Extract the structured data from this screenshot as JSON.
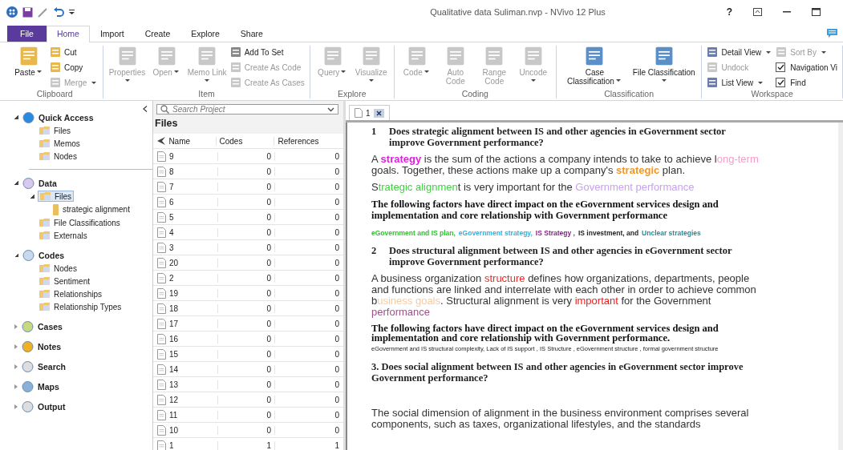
{
  "window": {
    "title": "Qualitative data Suliman.nvp - NVivo 12 Plus",
    "help": "?"
  },
  "tabs": [
    {
      "label": "File",
      "kind": "file",
      "selected": false
    },
    {
      "label": "Home",
      "kind": "tab",
      "selected": true
    },
    {
      "label": "Import",
      "kind": "tab",
      "selected": false
    },
    {
      "label": "Create",
      "kind": "tab",
      "selected": false
    },
    {
      "label": "Explore",
      "kind": "tab",
      "selected": false
    },
    {
      "label": "Share",
      "kind": "tab",
      "selected": false
    }
  ],
  "ribbon": [
    {
      "name": "Clipboard",
      "items": [
        {
          "kind": "large",
          "label": "Paste",
          "disabled": false,
          "dropdown": true
        },
        {
          "kind": "small",
          "label": "Cut",
          "disabled": false,
          "dropdown": false
        },
        {
          "kind": "small",
          "label": "Copy",
          "disabled": false,
          "dropdown": false
        },
        {
          "kind": "small",
          "label": "Merge",
          "disabled": true,
          "dropdown": true
        }
      ]
    },
    {
      "name": "Item",
      "items": [
        {
          "kind": "large",
          "label": "Properties",
          "disabled": true,
          "dropdown": true
        },
        {
          "kind": "large",
          "label": "Open",
          "disabled": true,
          "dropdown": true
        },
        {
          "kind": "large",
          "label": "Memo Link",
          "disabled": true,
          "dropdown": true
        },
        {
          "kind": "small",
          "label": "Add To Set",
          "disabled": false,
          "dropdown": false
        },
        {
          "kind": "small",
          "label": "Create As Code",
          "disabled": true,
          "dropdown": false
        },
        {
          "kind": "small",
          "label": "Create As Cases",
          "disabled": true,
          "dropdown": false
        }
      ]
    },
    {
      "name": "Explore",
      "items": [
        {
          "kind": "large",
          "label": "Query",
          "disabled": true,
          "dropdown": true
        },
        {
          "kind": "large",
          "label": "Visualize",
          "disabled": true,
          "dropdown": true
        }
      ]
    },
    {
      "name": "Coding",
      "items": [
        {
          "kind": "large",
          "label": "Code",
          "disabled": true,
          "dropdown": true
        },
        {
          "kind": "large",
          "label": "Auto Code",
          "disabled": true,
          "dropdown": false
        },
        {
          "kind": "large",
          "label": "Range Code",
          "disabled": true,
          "dropdown": false
        },
        {
          "kind": "large",
          "label": "Uncode",
          "disabled": true,
          "dropdown": true
        }
      ]
    },
    {
      "name": "Classification",
      "items": [
        {
          "kind": "large",
          "label": "Case Classification",
          "disabled": false,
          "dropdown": true
        },
        {
          "kind": "large",
          "label": "File Classification",
          "disabled": false,
          "dropdown": true
        }
      ]
    },
    {
      "name": "Workspace",
      "items": [
        {
          "kind": "small",
          "label": "Detail View",
          "disabled": false,
          "dropdown": true
        },
        {
          "kind": "small",
          "label": "Undock",
          "disabled": true,
          "dropdown": false
        },
        {
          "kind": "small",
          "label": "List View",
          "disabled": false,
          "dropdown": true
        },
        {
          "kind": "small",
          "label": "Sort By",
          "disabled": true,
          "dropdown": true
        },
        {
          "kind": "check",
          "label": "Navigation Vi",
          "checked": true
        },
        {
          "kind": "check",
          "label": "Find",
          "checked": true
        }
      ]
    }
  ],
  "navigation": [
    {
      "label": "Quick Access",
      "expanded": true,
      "children": [
        {
          "label": "Files",
          "selected": false
        },
        {
          "label": "Memos",
          "selected": false
        },
        {
          "label": "Nodes",
          "selected": false
        }
      ]
    },
    {
      "label": "Data",
      "expanded": true,
      "children": [
        {
          "label": "Files",
          "selected": true,
          "expanded": true,
          "children": [
            {
              "label": "strategic alignment",
              "selected": false
            }
          ]
        },
        {
          "label": "File Classifications",
          "selected": false
        },
        {
          "label": "Externals",
          "selected": false
        }
      ]
    },
    {
      "label": "Codes",
      "expanded": true,
      "children": [
        {
          "label": "Nodes",
          "selected": false
        },
        {
          "label": "Sentiment",
          "selected": false
        },
        {
          "label": "Relationships",
          "selected": false
        },
        {
          "label": "Relationship Types",
          "selected": false
        }
      ]
    },
    {
      "label": "Cases",
      "expanded": false
    },
    {
      "label": "Notes",
      "expanded": false
    },
    {
      "label": "Search",
      "expanded": false
    },
    {
      "label": "Maps",
      "expanded": false
    },
    {
      "label": "Output",
      "expanded": false
    }
  ],
  "files": {
    "search": {
      "placeholder": "Search Project"
    },
    "title": "Files",
    "columns": [
      "Name",
      "Codes",
      "References"
    ],
    "rows": [
      [
        "9",
        "0",
        "0"
      ],
      [
        "8",
        "0",
        "0"
      ],
      [
        "7",
        "0",
        "0"
      ],
      [
        "6",
        "0",
        "0"
      ],
      [
        "5",
        "0",
        "0"
      ],
      [
        "4",
        "0",
        "0"
      ],
      [
        "3",
        "0",
        "0"
      ],
      [
        "20",
        "0",
        "0"
      ],
      [
        "2",
        "0",
        "0"
      ],
      [
        "19",
        "0",
        "0"
      ],
      [
        "18",
        "0",
        "0"
      ],
      [
        "17",
        "0",
        "0"
      ],
      [
        "16",
        "0",
        "0"
      ],
      [
        "15",
        "0",
        "0"
      ],
      [
        "14",
        "0",
        "0"
      ],
      [
        "13",
        "0",
        "0"
      ],
      [
        "12",
        "0",
        "0"
      ],
      [
        "11",
        "0",
        "0"
      ],
      [
        "10",
        "0",
        "0"
      ],
      [
        "1",
        "1",
        "1"
      ]
    ]
  },
  "document": {
    "tab": "1",
    "paragraphs": [
      {
        "kind": "heading",
        "number": "1",
        "text": "Does strategic alignment between IS and other agencies in eGovernment sector improve Government performance?"
      },
      {
        "kind": "body",
        "runs": [
          {
            "text": "A "
          },
          {
            "text": "**strategy**",
            "color": "#e21ee2"
          },
          {
            "text": " is the sum of the actions a company intends to take to achieve l"
          },
          {
            "text": "ong-term",
            "color": "#f59ccc"
          },
          {
            "text": " goals. Together, these actions make up a company's "
          },
          {
            "text": "**strategic**",
            "color": "#f5961e"
          },
          {
            "text": " plan."
          }
        ]
      },
      {
        "kind": "body",
        "runs": [
          {
            "text": "S"
          },
          {
            "text": "trategic alignmen",
            "color": "#3cd23c"
          },
          {
            "text": "t is very important for the "
          },
          {
            "text": "Government performance",
            "color": "#c8a0f5"
          }
        ]
      },
      {
        "kind": "bold",
        "runs": [
          {
            "text": "The following factors have direct impact on the eGovernment services design and implementation and core relationship with Government performance"
          }
        ]
      },
      {
        "kind": "small",
        "runs": [
          {
            "text": "eGovernment and IS plan, ",
            "color": "#28c828"
          },
          {
            "text": "eGovernment strategy, ",
            "color": "#28b4e6"
          },
          {
            "text": "IS Strategy ,",
            "color": "#8c1e8c"
          },
          {
            "text": " IS investment, and "
          },
          {
            "text": "Unclear strategies",
            "color": "#288c9a"
          }
        ]
      },
      {
        "kind": "heading",
        "number": "2",
        "text": "Does structural alignment between IS and other agencies in eGovernment sector improve Government performance?"
      },
      {
        "kind": "body",
        "runs": [
          {
            "text": "A business organization "
          },
          {
            "text": "structure",
            "color": "#f02828"
          },
          {
            "text": " defines how organizations, departments, people and functions are linked and interrelate with each other in order to achieve common b"
          },
          {
            "text": "usiness goals",
            "color": "#f7caa0"
          },
          {
            "text": ". Structural alignment is very "
          },
          {
            "text": "important",
            "color": "#f01a1a"
          },
          {
            "text": " for the Government "
          },
          {
            "text": "performance",
            "color": "#a0508c"
          }
        ]
      },
      {
        "kind": "mixed",
        "runs": [
          {
            "kind": "bold",
            "text": "The following factors have direct impact on the eGovernment services design and implementation and core relationship with Government performance."
          },
          {
            "kind": "small",
            "text": " eGovernment and IS structural complexity, Lack of IS support , IS Structure , eGovernment structure , formal government structure"
          }
        ]
      },
      {
        "kind": "heading",
        "text": "3. Does social alignment between IS and other agencies in eGovernment sector improve Government performance?"
      },
      {
        "kind": "spaced",
        "runs": [
          {
            "text": "The social dimension of alignment in the business environment comprises several components, such as taxes, organizational lifestyles, and the standards"
          }
        ]
      }
    ]
  }
}
